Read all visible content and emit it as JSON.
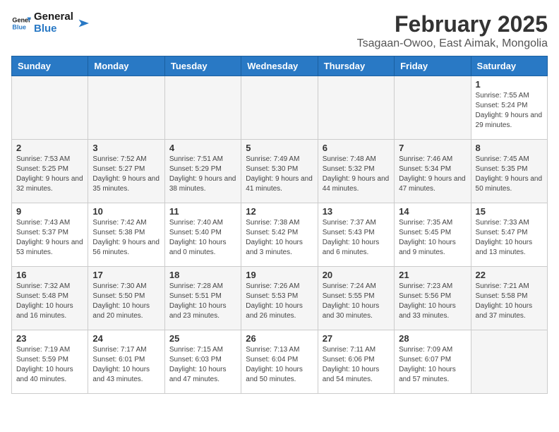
{
  "header": {
    "logo_line1": "General",
    "logo_line2": "Blue",
    "month_title": "February 2025",
    "location": "Tsagaan-Owoo, East Aimak, Mongolia"
  },
  "days_of_week": [
    "Sunday",
    "Monday",
    "Tuesday",
    "Wednesday",
    "Thursday",
    "Friday",
    "Saturday"
  ],
  "weeks": [
    [
      {
        "day": "",
        "info": ""
      },
      {
        "day": "",
        "info": ""
      },
      {
        "day": "",
        "info": ""
      },
      {
        "day": "",
        "info": ""
      },
      {
        "day": "",
        "info": ""
      },
      {
        "day": "",
        "info": ""
      },
      {
        "day": "1",
        "info": "Sunrise: 7:55 AM\nSunset: 5:24 PM\nDaylight: 9 hours and 29 minutes."
      }
    ],
    [
      {
        "day": "2",
        "info": "Sunrise: 7:53 AM\nSunset: 5:25 PM\nDaylight: 9 hours and 32 minutes."
      },
      {
        "day": "3",
        "info": "Sunrise: 7:52 AM\nSunset: 5:27 PM\nDaylight: 9 hours and 35 minutes."
      },
      {
        "day": "4",
        "info": "Sunrise: 7:51 AM\nSunset: 5:29 PM\nDaylight: 9 hours and 38 minutes."
      },
      {
        "day": "5",
        "info": "Sunrise: 7:49 AM\nSunset: 5:30 PM\nDaylight: 9 hours and 41 minutes."
      },
      {
        "day": "6",
        "info": "Sunrise: 7:48 AM\nSunset: 5:32 PM\nDaylight: 9 hours and 44 minutes."
      },
      {
        "day": "7",
        "info": "Sunrise: 7:46 AM\nSunset: 5:34 PM\nDaylight: 9 hours and 47 minutes."
      },
      {
        "day": "8",
        "info": "Sunrise: 7:45 AM\nSunset: 5:35 PM\nDaylight: 9 hours and 50 minutes."
      }
    ],
    [
      {
        "day": "9",
        "info": "Sunrise: 7:43 AM\nSunset: 5:37 PM\nDaylight: 9 hours and 53 minutes."
      },
      {
        "day": "10",
        "info": "Sunrise: 7:42 AM\nSunset: 5:38 PM\nDaylight: 9 hours and 56 minutes."
      },
      {
        "day": "11",
        "info": "Sunrise: 7:40 AM\nSunset: 5:40 PM\nDaylight: 10 hours and 0 minutes."
      },
      {
        "day": "12",
        "info": "Sunrise: 7:38 AM\nSunset: 5:42 PM\nDaylight: 10 hours and 3 minutes."
      },
      {
        "day": "13",
        "info": "Sunrise: 7:37 AM\nSunset: 5:43 PM\nDaylight: 10 hours and 6 minutes."
      },
      {
        "day": "14",
        "info": "Sunrise: 7:35 AM\nSunset: 5:45 PM\nDaylight: 10 hours and 9 minutes."
      },
      {
        "day": "15",
        "info": "Sunrise: 7:33 AM\nSunset: 5:47 PM\nDaylight: 10 hours and 13 minutes."
      }
    ],
    [
      {
        "day": "16",
        "info": "Sunrise: 7:32 AM\nSunset: 5:48 PM\nDaylight: 10 hours and 16 minutes."
      },
      {
        "day": "17",
        "info": "Sunrise: 7:30 AM\nSunset: 5:50 PM\nDaylight: 10 hours and 20 minutes."
      },
      {
        "day": "18",
        "info": "Sunrise: 7:28 AM\nSunset: 5:51 PM\nDaylight: 10 hours and 23 minutes."
      },
      {
        "day": "19",
        "info": "Sunrise: 7:26 AM\nSunset: 5:53 PM\nDaylight: 10 hours and 26 minutes."
      },
      {
        "day": "20",
        "info": "Sunrise: 7:24 AM\nSunset: 5:55 PM\nDaylight: 10 hours and 30 minutes."
      },
      {
        "day": "21",
        "info": "Sunrise: 7:23 AM\nSunset: 5:56 PM\nDaylight: 10 hours and 33 minutes."
      },
      {
        "day": "22",
        "info": "Sunrise: 7:21 AM\nSunset: 5:58 PM\nDaylight: 10 hours and 37 minutes."
      }
    ],
    [
      {
        "day": "23",
        "info": "Sunrise: 7:19 AM\nSunset: 5:59 PM\nDaylight: 10 hours and 40 minutes."
      },
      {
        "day": "24",
        "info": "Sunrise: 7:17 AM\nSunset: 6:01 PM\nDaylight: 10 hours and 43 minutes."
      },
      {
        "day": "25",
        "info": "Sunrise: 7:15 AM\nSunset: 6:03 PM\nDaylight: 10 hours and 47 minutes."
      },
      {
        "day": "26",
        "info": "Sunrise: 7:13 AM\nSunset: 6:04 PM\nDaylight: 10 hours and 50 minutes."
      },
      {
        "day": "27",
        "info": "Sunrise: 7:11 AM\nSunset: 6:06 PM\nDaylight: 10 hours and 54 minutes."
      },
      {
        "day": "28",
        "info": "Sunrise: 7:09 AM\nSunset: 6:07 PM\nDaylight: 10 hours and 57 minutes."
      },
      {
        "day": "",
        "info": ""
      }
    ]
  ]
}
